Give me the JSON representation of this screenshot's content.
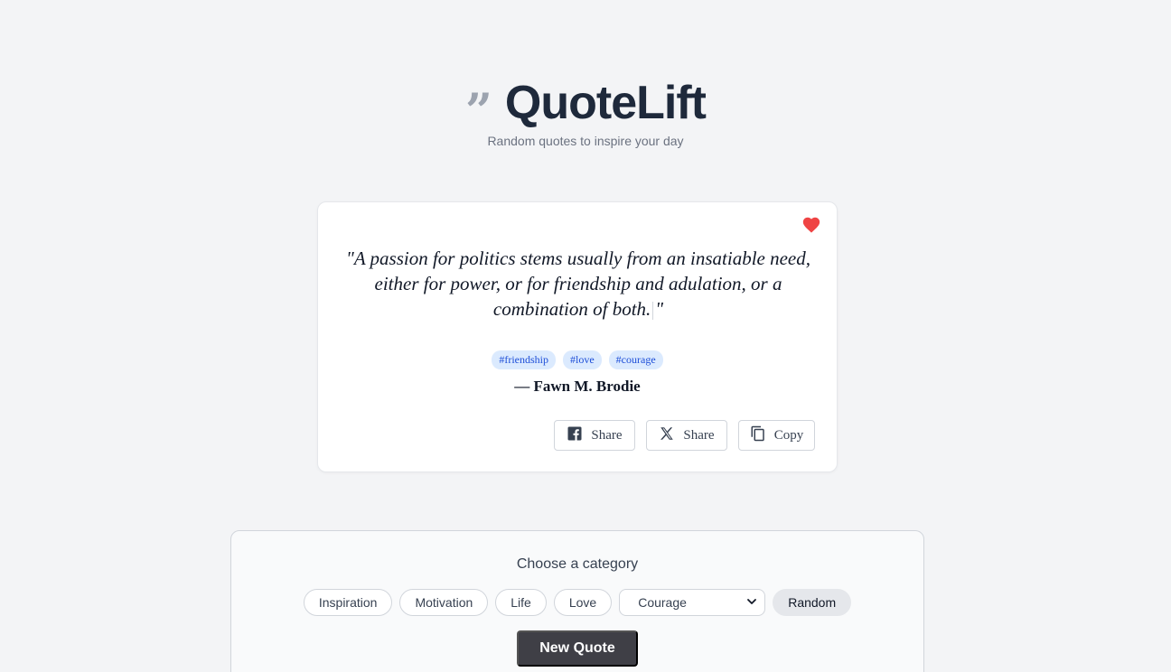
{
  "header": {
    "brand_mark": "”",
    "title": "QuoteLift",
    "tagline": "Random quotes to inspire your day"
  },
  "quote": {
    "open_mark": "\"",
    "text": "A passion for politics stems usually from an insatiable need, either for power, or for friendship and adulation, or a combination of both.",
    "close_mark": "\"",
    "tags": [
      "#friendship",
      "#love",
      "#courage"
    ],
    "author": "— Fawn M. Brodie",
    "favorite": true,
    "colors": {
      "heart": "#ef4444",
      "tag_bg": "#dbeafe",
      "tag_text": "#1d4ed8"
    }
  },
  "actions": {
    "facebook_share_label": "Share",
    "x_share_label": "Share",
    "copy_label": "Copy"
  },
  "categories": {
    "title": "Choose a category",
    "chips": [
      "Inspiration",
      "Motivation",
      "Life",
      "Love"
    ],
    "select_value": "Courage",
    "random_label": "Random",
    "new_quote_label": "New Quote"
  },
  "icons": {
    "favorite": "heart-icon",
    "facebook": "facebook-icon",
    "x": "x-logo-icon",
    "copy": "copy-icon",
    "select": "chevron-down-icon"
  }
}
